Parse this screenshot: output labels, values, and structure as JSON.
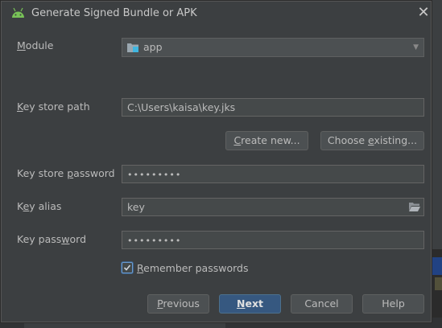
{
  "dialog": {
    "title": "Generate Signed Bundle or APK",
    "close_glyph": "✕"
  },
  "module": {
    "label_first": "M",
    "label_rest": "odule",
    "value": "app"
  },
  "key_store_path": {
    "label_first": "K",
    "label_rest": "ey store path",
    "value": "C:\\Users\\kaisa\\key.jks"
  },
  "buttons": {
    "create_new_first": "C",
    "create_new_rest": "reate new...",
    "choose_existing_first": "Choose ",
    "choose_existing_ul": "e",
    "choose_existing_rest": "xisting...",
    "previous_first": "P",
    "previous_rest": "revious",
    "next_first": "N",
    "next_rest": "ext",
    "cancel": "Cancel",
    "help": "Help"
  },
  "key_store_password": {
    "label_first": "Key store ",
    "label_ul": "p",
    "label_rest": "assword",
    "value": "•••••••••"
  },
  "key_alias": {
    "label_first": "K",
    "label_ul": "e",
    "label_rest": "y alias",
    "value": "key"
  },
  "key_password": {
    "label_first": "Key pass",
    "label_ul": "w",
    "label_rest": "ord",
    "value": "•••••••••"
  },
  "remember": {
    "label_first": "R",
    "label_rest": "emember passwords",
    "checked": true
  },
  "colors": {
    "background": "#3c3f41",
    "field_bg": "#45494a",
    "primary_button": "#365880",
    "checkbox_border": "#6b9bd2",
    "android_green": "#78c257"
  },
  "icons": [
    "android-logo-icon",
    "close-icon",
    "module-folder-icon",
    "chevron-down-icon",
    "open-folder-icon",
    "checkmark-icon"
  ]
}
